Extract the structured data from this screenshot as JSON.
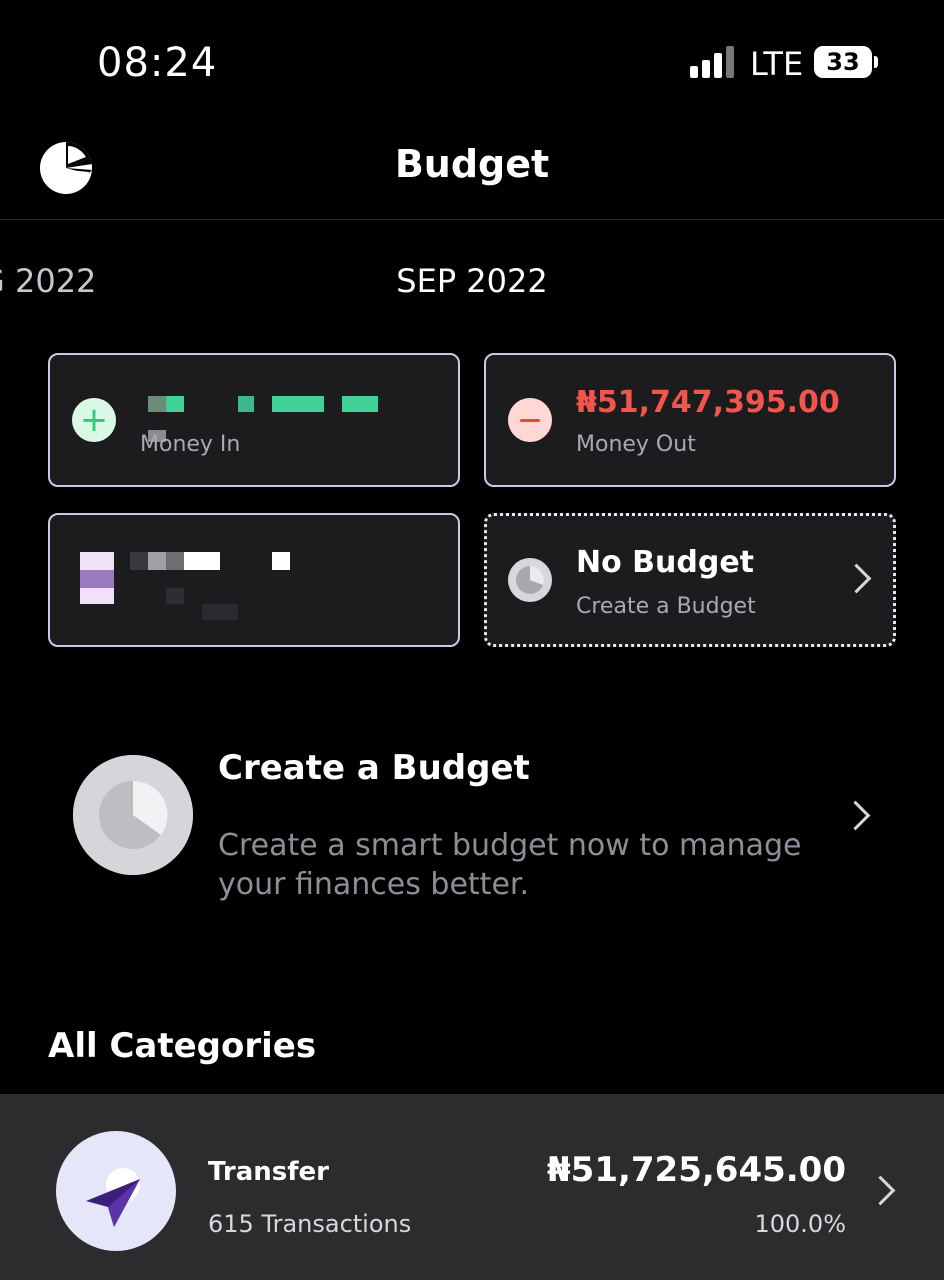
{
  "status_bar": {
    "time": "08:24",
    "network": "LTE",
    "battery": "33"
  },
  "header": {
    "title": "Budget",
    "logo_icon": "pie-logo-icon"
  },
  "month_selector": {
    "previous": "G 2022",
    "current": "SEP 2022"
  },
  "summary": {
    "money_in": {
      "label": "Money In",
      "icon": "plus-icon"
    },
    "money_out": {
      "amount": "₦51,747,395.00",
      "label": "Money Out",
      "icon": "minus-icon"
    },
    "budget": {
      "title": "No Budget",
      "subtitle": "Create a Budget"
    }
  },
  "promo": {
    "title": "Create a Budget",
    "description": "Create a smart budget now to manage your finances better."
  },
  "categories": {
    "title": "All Categories",
    "items": [
      {
        "name": "Transfer",
        "count": "615 Transactions",
        "amount": "₦51,725,645.00",
        "percent": "100.0%",
        "icon": "paper-plane-icon"
      }
    ]
  },
  "colors": {
    "background": "#000000",
    "card": "#1c1c1f",
    "negative": "#f2554c",
    "positive": "#2fc979",
    "row": "#2c2c2f"
  }
}
